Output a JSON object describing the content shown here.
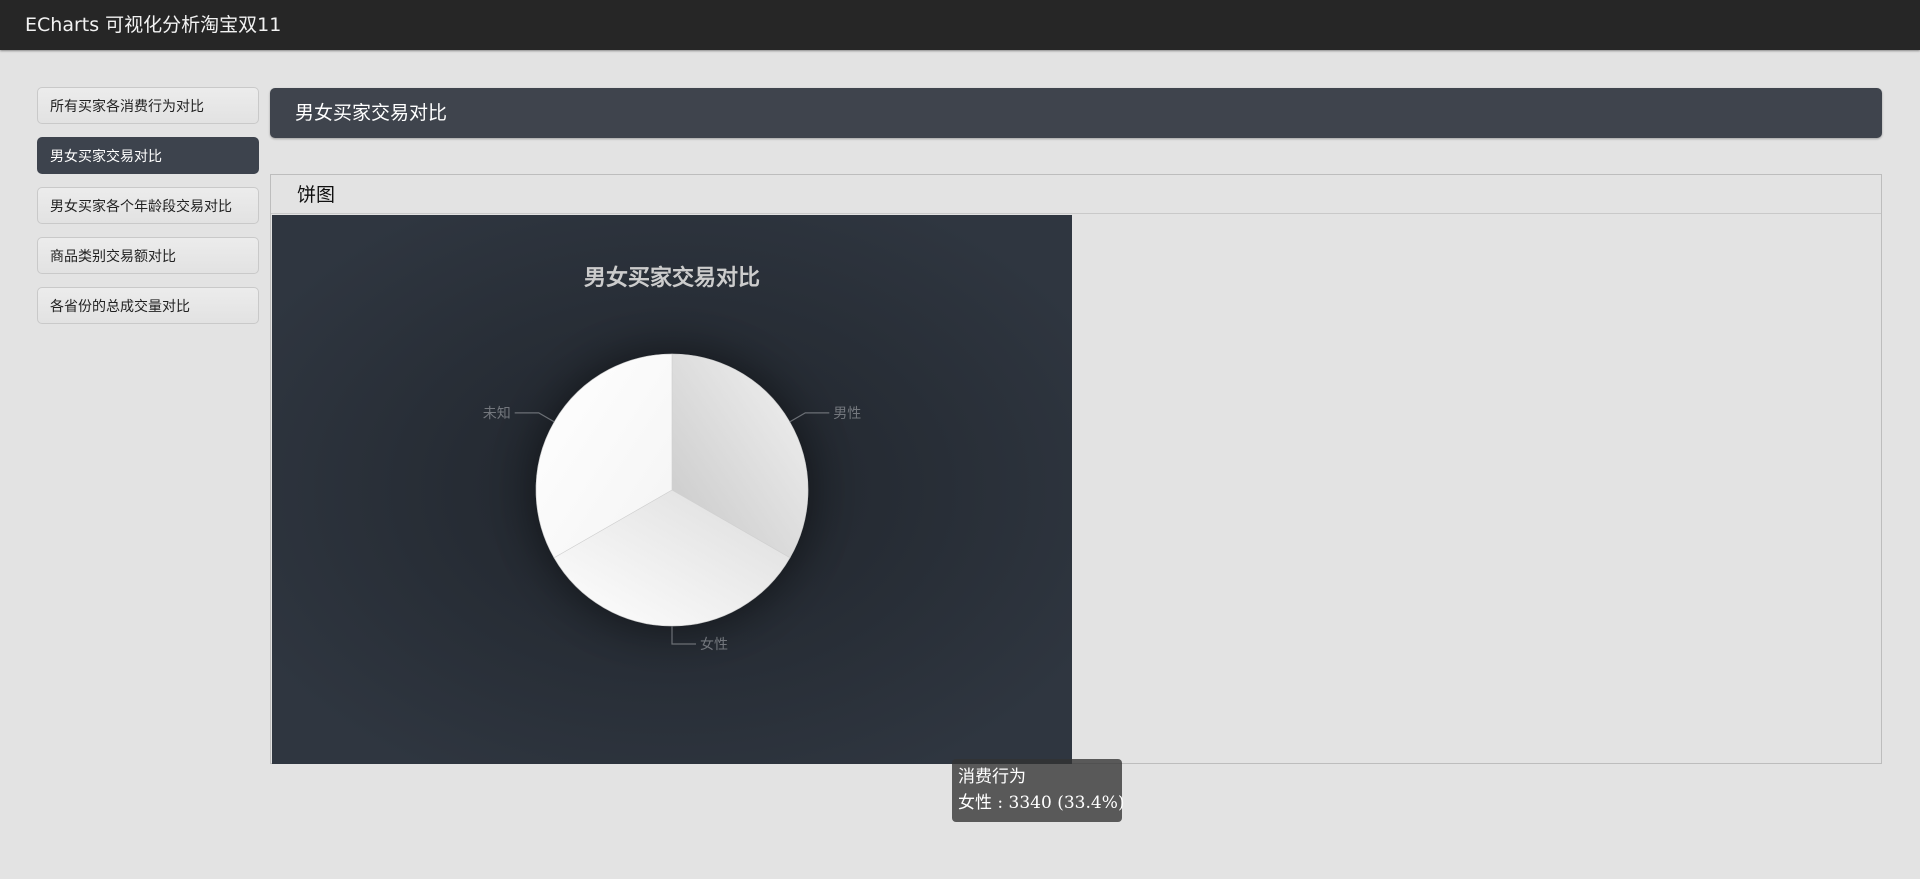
{
  "app": {
    "title": "ECharts 可视化分析淘宝双11"
  },
  "sidebar": {
    "items": [
      {
        "label": "所有买家各消费行为对比",
        "active": false
      },
      {
        "label": "男女买家交易对比",
        "active": true
      },
      {
        "label": "男女买家各个年龄段交易对比",
        "active": false
      },
      {
        "label": "商品类别交易额对比",
        "active": false
      },
      {
        "label": "各省份的总成交量对比",
        "active": false
      }
    ]
  },
  "header": {
    "title": "男女买家交易对比"
  },
  "panel": {
    "title": "饼图"
  },
  "colors": {
    "topbar": "#262626",
    "page_bg": "#e3e3e3",
    "header_bg": "#3f444d",
    "chart_bg_center": "#1f242b",
    "chart_bg_edge": "#2f3640"
  },
  "tooltip": {
    "series_name": "消费行为",
    "label": "女性",
    "value": "3340",
    "percent": "33.4%"
  },
  "chart_data": {
    "type": "pie",
    "title": "男女买家交易对比",
    "categories": [
      "男性",
      "女性",
      "未知"
    ],
    "values": [
      3330,
      3340,
      3330
    ],
    "legend": "none",
    "start_angle_deg": 90,
    "direction": "clockwise"
  }
}
